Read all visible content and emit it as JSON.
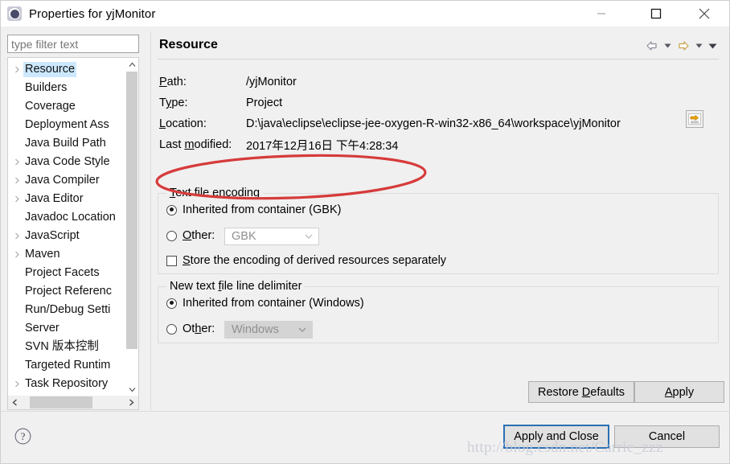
{
  "window": {
    "title": "Properties for yjMonitor",
    "app_icon": "eclipse-properties-icon",
    "minimize_label": "Minimize",
    "maximize_label": "Maximize",
    "close_label": "Close"
  },
  "sidebar": {
    "filter": {
      "placeholder": "type filter text",
      "value": ""
    },
    "items": [
      {
        "label": "Resource",
        "expandable": true,
        "selected": true
      },
      {
        "label": "Builders",
        "expandable": false,
        "selected": false
      },
      {
        "label": "Coverage",
        "expandable": false,
        "selected": false
      },
      {
        "label": "Deployment Ass",
        "expandable": false,
        "selected": false
      },
      {
        "label": "Java Build Path",
        "expandable": false,
        "selected": false
      },
      {
        "label": "Java Code Style",
        "expandable": true,
        "selected": false
      },
      {
        "label": "Java Compiler",
        "expandable": true,
        "selected": false
      },
      {
        "label": "Java Editor",
        "expandable": true,
        "selected": false
      },
      {
        "label": "Javadoc Location",
        "expandable": false,
        "selected": false
      },
      {
        "label": "JavaScript",
        "expandable": true,
        "selected": false
      },
      {
        "label": "Maven",
        "expandable": true,
        "selected": false
      },
      {
        "label": "Project Facets",
        "expandable": false,
        "selected": false
      },
      {
        "label": "Project Referenc",
        "expandable": false,
        "selected": false
      },
      {
        "label": "Run/Debug Setti",
        "expandable": false,
        "selected": false
      },
      {
        "label": "Server",
        "expandable": false,
        "selected": false
      },
      {
        "label": "SVN 版本控制",
        "expandable": false,
        "selected": false
      },
      {
        "label": "Targeted Runtim",
        "expandable": false,
        "selected": false
      },
      {
        "label": "Task Repository",
        "expandable": true,
        "selected": false
      }
    ]
  },
  "pane": {
    "title": "Resource",
    "nav": {
      "back": "back-arrow",
      "back_menu": "back-dropdown",
      "forward": "forward-arrow",
      "forward_menu": "forward-dropdown",
      "view_menu": "view-menu"
    },
    "info": {
      "path_label": "Path:",
      "path_value": "/yjMonitor",
      "type_label": "Type:",
      "type_value": "Project",
      "location_label": "Location:",
      "location_value": "D:\\java\\eclipse\\eclipse-jee-oxygen-R-win32-x86_64\\workspace\\yjMonitor",
      "location_button": "resolve-path-variable-icon",
      "last_modified_label": "Last modified:",
      "last_modified_value": "2017年12月16日 下午4:28:34"
    },
    "encoding_group": {
      "title": "Text file encoding",
      "inherited_label": "Inherited from container (GBK)",
      "inherited_checked": true,
      "other_label": "Other:",
      "other_checked": false,
      "other_value": "GBK",
      "store_derived_label": "Store the encoding of derived resources separately",
      "store_derived_checked": false
    },
    "delimiter_group": {
      "title": "New text file line delimiter",
      "inherited_label": "Inherited from container (Windows)",
      "inherited_checked": true,
      "other_label": "Other:",
      "other_checked": false,
      "other_value": "Windows"
    },
    "restore_defaults_label": "Restore Defaults",
    "apply_label": "Apply"
  },
  "footer": {
    "help_icon": "help-icon",
    "apply_and_close_label": "Apply and Close",
    "cancel_label": "Cancel"
  },
  "annotation": {
    "shape": "red-ellipse",
    "color": "#d63b3b",
    "target": "Text file encoding / Inherited from container (GBK)"
  },
  "watermark": {
    "text": "http://blog.csdn.net/Carrie_zzz",
    "color": "#c8cbd6"
  }
}
